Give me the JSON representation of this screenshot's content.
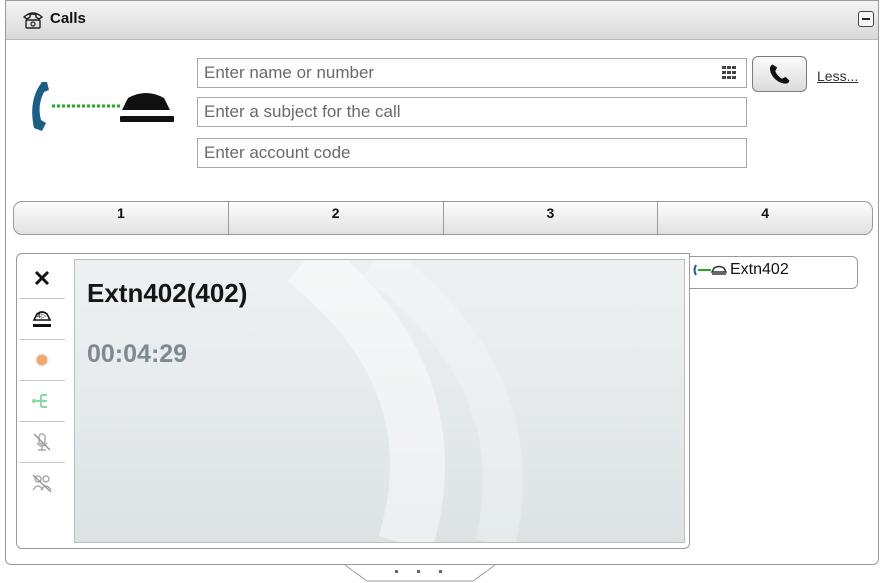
{
  "window": {
    "title": "Calls",
    "title_icon": "telephone-icon",
    "minimize_icon": "minimize-icon"
  },
  "dialer": {
    "status_graphic": "handset-connection-icon",
    "name_field": {
      "placeholder": "Enter name or number",
      "value": ""
    },
    "subject_field": {
      "placeholder": "Enter a subject for the call",
      "value": ""
    },
    "account_field": {
      "placeholder": "Enter account code",
      "value": ""
    },
    "keypad_icon": "keypad-icon",
    "call_button_icon": "phone-icon",
    "less_link": "Less..."
  },
  "tabs": [
    {
      "label": "1"
    },
    {
      "label": "2"
    },
    {
      "label": "3"
    },
    {
      "label": "4"
    }
  ],
  "active_call": {
    "name": "Extn402(402)",
    "timer": "00:04:29",
    "tab_label": "Extn402",
    "tab_icon": "connected-call-icon"
  },
  "call_controls": [
    {
      "icon": "close-icon",
      "enabled": true
    },
    {
      "icon": "hold-icon",
      "enabled": true
    },
    {
      "icon": "record-icon",
      "enabled": false
    },
    {
      "icon": "transfer-icon",
      "enabled": false
    },
    {
      "icon": "mute-icon",
      "enabled": false
    },
    {
      "icon": "conference-mute-icon",
      "enabled": false
    }
  ],
  "colors": {
    "connected_line": "#22aa22",
    "handset": "#1c5e86",
    "record": "#f3a86b",
    "transfer": "#8fd7a6"
  }
}
